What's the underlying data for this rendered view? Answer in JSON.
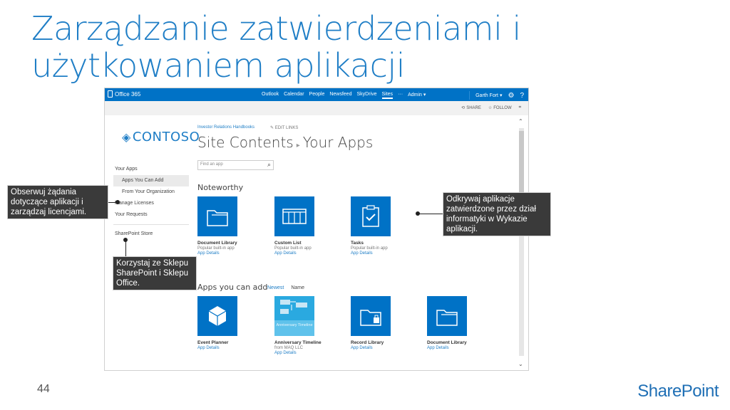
{
  "slide": {
    "title": "Zarządzanie zatwierdzeniami i użytkowaniem aplikacji",
    "number": "44",
    "brand": "SharePoint"
  },
  "suitebar": {
    "product": "Office 365",
    "links": [
      "Outlook",
      "Calendar",
      "People",
      "Newsfeed",
      "SkyDrive",
      "Sites",
      "···",
      "Admin ▾"
    ],
    "active_link": "Sites",
    "user": "Garth Fort ▾",
    "settings_icon": "gear-icon",
    "help_label": "?"
  },
  "ribbon": {
    "share_label": "SHARE",
    "follow_label": "FOLLOW"
  },
  "site": {
    "logo_text": "CONTOSO",
    "breadcrumb_link": "Investor Relations Handbooks",
    "edit_links": "EDIT LINKS",
    "heading_main": "Site Contents",
    "heading_sep": "▸",
    "heading_sub": "Your Apps"
  },
  "leftnav": {
    "your_apps": "Your Apps",
    "apps_you_can_add": "Apps You Can Add",
    "from_org": "From Your Organization",
    "manage_licenses": "Manage Licenses",
    "your_requests": "Your Requests",
    "store": "SharePoint Store"
  },
  "search": {
    "placeholder": "Find an app"
  },
  "noteworthy": {
    "title": "Noteworthy",
    "tiles": [
      {
        "name": "Document Library",
        "desc": "Popular built-in app",
        "details": "App Details"
      },
      {
        "name": "Custom List",
        "desc": "Popular built-in app",
        "details": "App Details"
      },
      {
        "name": "Tasks",
        "desc": "Popular built-in app",
        "details": "App Details"
      }
    ]
  },
  "apps_add": {
    "title": "Apps you can add",
    "sort_newest": "Newest",
    "sort_name": "Name",
    "tiles": [
      {
        "name": "Event Planner",
        "desc": "",
        "details": "App Details"
      },
      {
        "name": "Anniversary Timeline",
        "desc": "from MAQ LLC",
        "details": "App Details",
        "icon_caption": "Anniversary Timeline"
      },
      {
        "name": "Record Library",
        "desc": "",
        "details": "App Details"
      },
      {
        "name": "Document Library",
        "desc": "",
        "details": "App Details"
      }
    ]
  },
  "callouts": {
    "left": "Obserwuj żądania dotyczące aplikacji i zarządzaj licencjami.",
    "bottom": "Korzystaj ze Sklepu SharePoint i Sklepu Office.",
    "right": "Odkrywaj aplikacje zatwierdzone przez dział informatyki w Wykazie aplikacji."
  },
  "colors": {
    "accent": "#0072c6",
    "title": "#1f7ec6",
    "callout_bg": "#3a3a3a"
  }
}
